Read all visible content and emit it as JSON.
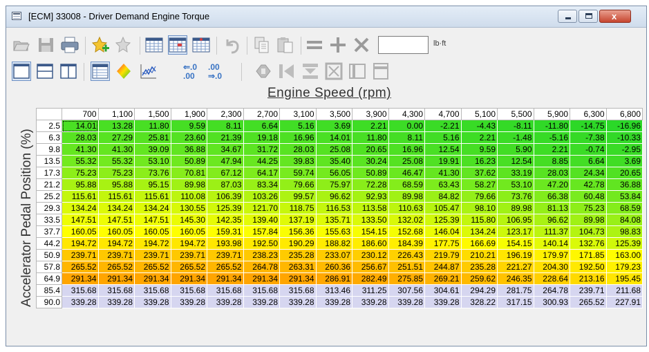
{
  "window": {
    "title": "[ECM] 33008 - Driver Demand Engine Torque",
    "min_label": "_",
    "max_label": "□",
    "close_label": "x"
  },
  "toolbar": {
    "row1": [
      "open-icon",
      "save-icon",
      "print-icon",
      "favorite-add-icon",
      "favorite-icon",
      "table-view-icon",
      "table-compare-icon",
      "table-diff-icon",
      "undo-icon",
      "copy-icon",
      "paste-icon",
      "equals-icon",
      "plus-icon",
      "multiply-icon"
    ],
    "row2": [
      "single-view-icon",
      "horizontal-split-icon",
      "vertical-split-icon",
      "table-properties-icon",
      "color-map-icon",
      "graph-icon",
      "increase-decimals-icon",
      "decrease-decimals-icon",
      "interpolate-icon",
      "smooth-icon",
      "fill-icon",
      "select-all-icon",
      "clip-horizontal-icon",
      "clip-vertical-icon"
    ],
    "adjust_value": "",
    "unit": "lb·ft",
    "decimals_up": "⇐.0\n.00",
    "decimals_down": ".00\n⇒.0"
  },
  "table": {
    "x_axis_title": "Engine Speed (rpm)",
    "y_axis_title": "Accelerator Pedal Position (%)",
    "x_axis": [
      "700",
      "1,100",
      "1,500",
      "1,900",
      "2,300",
      "2,700",
      "3,100",
      "3,500",
      "3,900",
      "4,300",
      "4,700",
      "5,100",
      "5,500",
      "5,900",
      "6,300",
      "6,800"
    ],
    "y_axis": [
      "2.5",
      "6.3",
      "9.8",
      "13.5",
      "17.3",
      "21.2",
      "25.2",
      "29.3",
      "33.5",
      "37.7",
      "44.2",
      "50.9",
      "57.8",
      "64.9",
      "85.4",
      "90.0"
    ],
    "rows": [
      [
        "14.01",
        "13.28",
        "11.80",
        "9.59",
        "8.11",
        "6.64",
        "5.16",
        "3.69",
        "2.21",
        "0.00",
        "-2.21",
        "-4.43",
        "-8.11",
        "-11.80",
        "-14.75",
        "-16.96"
      ],
      [
        "28.03",
        "27.29",
        "25.81",
        "23.60",
        "21.39",
        "19.18",
        "16.96",
        "14.01",
        "11.80",
        "8.11",
        "5.16",
        "2.21",
        "-1.48",
        "-5.16",
        "-7.38",
        "-10.33"
      ],
      [
        "41.30",
        "41.30",
        "39.09",
        "36.88",
        "34.67",
        "31.72",
        "28.03",
        "25.08",
        "20.65",
        "16.96",
        "12.54",
        "9.59",
        "5.90",
        "2.21",
        "-0.74",
        "-2.95"
      ],
      [
        "55.32",
        "55.32",
        "53.10",
        "50.89",
        "47.94",
        "44.25",
        "39.83",
        "35.40",
        "30.24",
        "25.08",
        "19.91",
        "16.23",
        "12.54",
        "8.85",
        "6.64",
        "3.69"
      ],
      [
        "75.23",
        "75.23",
        "73.76",
        "70.81",
        "67.12",
        "64.17",
        "59.74",
        "56.05",
        "50.89",
        "46.47",
        "41.30",
        "37.62",
        "33.19",
        "28.03",
        "24.34",
        "20.65"
      ],
      [
        "95.88",
        "95.88",
        "95.15",
        "89.98",
        "87.03",
        "83.34",
        "79.66",
        "75.97",
        "72.28",
        "68.59",
        "63.43",
        "58.27",
        "53.10",
        "47.20",
        "42.78",
        "36.88"
      ],
      [
        "115.61",
        "115.61",
        "115.61",
        "110.08",
        "106.39",
        "103.26",
        "99.57",
        "96.62",
        "92.93",
        "89.98",
        "84.82",
        "79.66",
        "73.76",
        "66.38",
        "60.48",
        "53.84"
      ],
      [
        "134.24",
        "134.24",
        "134.24",
        "130.55",
        "125.39",
        "121.70",
        "118.75",
        "116.53",
        "113.58",
        "110.63",
        "105.47",
        "98.10",
        "89.98",
        "81.13",
        "75.23",
        "68.59"
      ],
      [
        "147.51",
        "147.51",
        "147.51",
        "145.30",
        "142.35",
        "139.40",
        "137.19",
        "135.71",
        "133.50",
        "132.02",
        "125.39",
        "115.80",
        "106.95",
        "96.62",
        "89.98",
        "84.08"
      ],
      [
        "160.05",
        "160.05",
        "160.05",
        "160.05",
        "159.31",
        "157.84",
        "156.36",
        "155.63",
        "154.15",
        "152.68",
        "146.04",
        "134.24",
        "123.17",
        "111.37",
        "104.73",
        "98.83"
      ],
      [
        "194.72",
        "194.72",
        "194.72",
        "194.72",
        "193.98",
        "192.50",
        "190.29",
        "188.82",
        "186.60",
        "184.39",
        "177.75",
        "166.69",
        "154.15",
        "140.14",
        "132.76",
        "125.39"
      ],
      [
        "239.71",
        "239.71",
        "239.71",
        "239.71",
        "239.71",
        "238.23",
        "235.28",
        "233.07",
        "230.12",
        "226.43",
        "219.79",
        "210.21",
        "196.19",
        "179.97",
        "171.85",
        "163.00"
      ],
      [
        "265.52",
        "265.52",
        "265.52",
        "265.52",
        "265.52",
        "264.78",
        "263.31",
        "260.36",
        "256.67",
        "251.51",
        "244.87",
        "235.28",
        "221.27",
        "204.30",
        "192.50",
        "179.23"
      ],
      [
        "291.34",
        "291.34",
        "291.34",
        "291.34",
        "291.34",
        "291.34",
        "291.34",
        "286.91",
        "282.49",
        "275.85",
        "269.21",
        "259.62",
        "246.35",
        "228.64",
        "213.16",
        "195.45"
      ],
      [
        "315.68",
        "315.68",
        "315.68",
        "315.68",
        "315.68",
        "315.68",
        "315.68",
        "313.46",
        "311.25",
        "307.56",
        "304.61",
        "294.29",
        "281.75",
        "264.78",
        "239.71",
        "211.68"
      ],
      [
        "339.28",
        "339.28",
        "339.28",
        "339.28",
        "339.28",
        "339.28",
        "339.28",
        "339.28",
        "339.28",
        "339.28",
        "339.28",
        "328.22",
        "317.15",
        "300.93",
        "265.52",
        "227.91"
      ]
    ]
  },
  "colors": {
    "low": "#1fd11f",
    "mid": "#ffff00",
    "high": "#ffa500",
    "top": "#d8d8ee",
    "title_text": "#333333",
    "cell_text": "#000000"
  }
}
